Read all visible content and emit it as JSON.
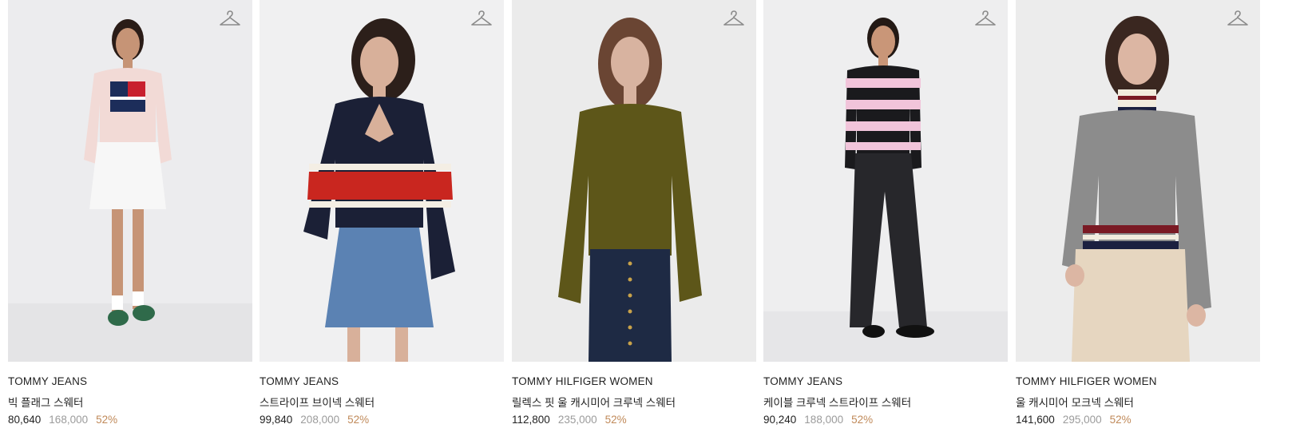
{
  "products": [
    {
      "brand": "TOMMY JEANS",
      "name": "빅 플래그 스웨터",
      "price": "80,640",
      "original_price": "168,000",
      "discount": "52%",
      "wishlist_icon": "hanger-icon",
      "colors": {
        "bg": "#ececee",
        "top": "#f2dad6",
        "bottom": "#f7f7f7",
        "skin": "#c69476",
        "hair": "#2a1c17",
        "shoes": "#2f6a4a"
      }
    },
    {
      "brand": "TOMMY JEANS",
      "name": "스트라이프 브이넥 스웨터",
      "price": "99,840",
      "original_price": "208,000",
      "discount": "52%",
      "wishlist_icon": "hanger-icon",
      "colors": {
        "bg": "#f0f0f1",
        "top": "#1b2036",
        "stripe": "#c9261f",
        "bottom": "#5b82b3",
        "skin": "#d8b09a",
        "hair": "#2c1f1a"
      }
    },
    {
      "brand": "TOMMY HILFIGER WOMEN",
      "name": "릴렉스 핏 울 캐시미어 크루넥 스웨터",
      "price": "112,800",
      "original_price": "235,000",
      "discount": "52%",
      "wishlist_icon": "hanger-icon",
      "colors": {
        "bg": "#ebebeb",
        "top": "#5d5619",
        "bottom": "#1e2a44",
        "skin": "#d8b3a0",
        "hair": "#6a4533"
      }
    },
    {
      "brand": "TOMMY JEANS",
      "name": "케이블 크루넥 스트라이프 스웨터",
      "price": "90,240",
      "original_price": "188,000",
      "discount": "52%",
      "wishlist_icon": "hanger-icon",
      "colors": {
        "bg": "#eeeeef",
        "top": "#1a1a1d",
        "stripe": "#f1c4da",
        "bottom": "#27272b",
        "skin": "#c99678",
        "hair": "#231915"
      }
    },
    {
      "brand": "TOMMY HILFIGER WOMEN",
      "name": "울 캐시미어 모크넥 스웨터",
      "price": "141,600",
      "original_price": "295,000",
      "discount": "52%",
      "wishlist_icon": "hanger-icon",
      "colors": {
        "bg": "#ececec",
        "top": "#8c8c8c",
        "stripe": "#7a1a24",
        "bottom": "#e6d6c0",
        "skin": "#dcb6a3",
        "hair": "#3a2720"
      }
    }
  ]
}
